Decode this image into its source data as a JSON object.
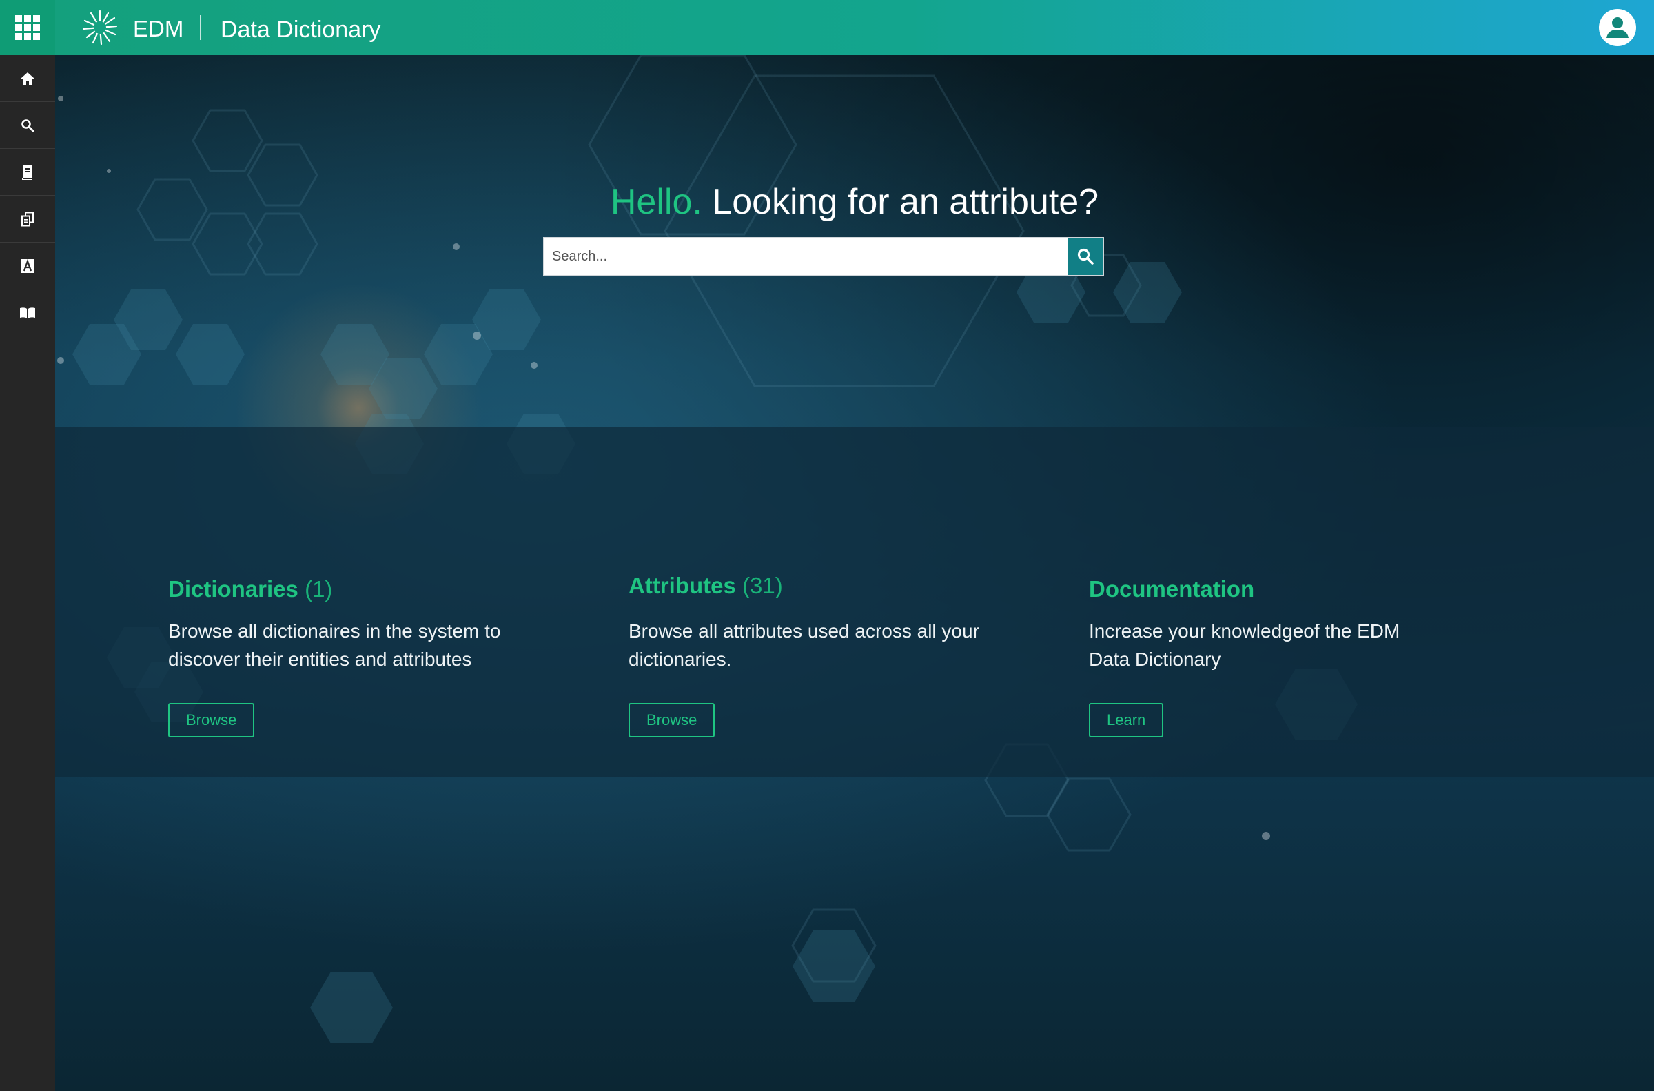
{
  "header": {
    "brand": "EDM",
    "app_title": "Data Dictionary",
    "apps_icon": "apps-grid-icon",
    "avatar_icon": "user-avatar-icon"
  },
  "sidebar": {
    "items": [
      {
        "icon": "home-icon"
      },
      {
        "icon": "search-icon"
      },
      {
        "icon": "dictionary-icon"
      },
      {
        "icon": "copy-documents-icon"
      },
      {
        "icon": "attribute-a-icon"
      },
      {
        "icon": "open-book-icon"
      }
    ]
  },
  "hero": {
    "greeting": "Hello.",
    "question": " Looking for an attribute?",
    "search_placeholder": "Search..."
  },
  "cards": [
    {
      "title": "Dictionaries",
      "count": " (1)",
      "description": "Browse all dictionaires in the system to discover their entities and attributes",
      "button": "Browse"
    },
    {
      "title": "Attributes",
      "count": " (31)",
      "description": "Browse all attributes used across all your dictionaries.",
      "button": "Browse"
    },
    {
      "title": "Documentation",
      "count": "",
      "description": "Increase your knowledgeof the EDM Data Dictionary",
      "button": "Learn"
    }
  ],
  "colors": {
    "accent_green": "#1fc482",
    "topbar_start": "#14a07c",
    "topbar_end": "#1ea6d3",
    "search_button": "#117f86",
    "sidebar_bg": "#262626"
  }
}
